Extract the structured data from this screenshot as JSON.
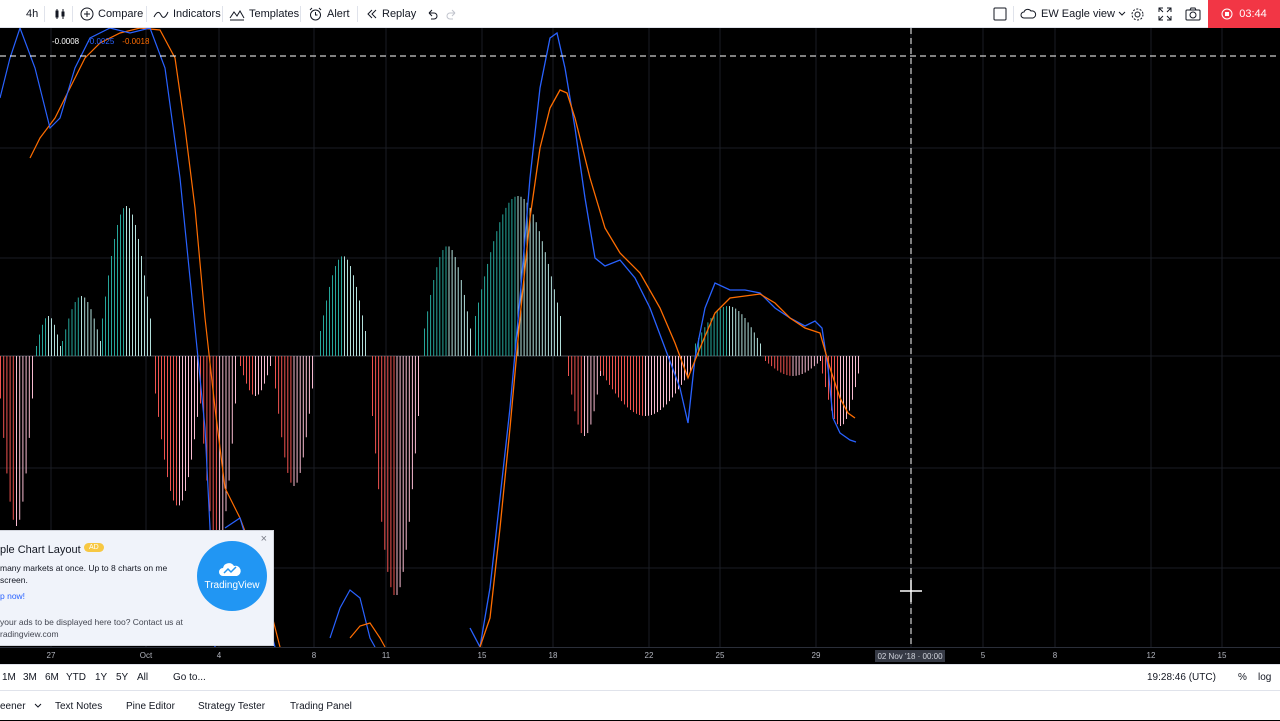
{
  "toolbar": {
    "interval": "4h",
    "compare": "Compare",
    "indicators": "Indicators",
    "templates": "Templates",
    "alert": "Alert",
    "replay": "Replay",
    "layout_name": "EW Eagle view",
    "rec_time": "03:44"
  },
  "legend": {
    "v1": "-0.0008",
    "v2": "-0.0025",
    "v3": "-0.0018",
    "colors": {
      "v1": "#ffffff",
      "v2": "#2962ff",
      "v3": "#ff6d00"
    }
  },
  "time_axis": {
    "ticks": [
      "27",
      "Oct",
      "4",
      "8",
      "11",
      "15",
      "18",
      "22",
      "25",
      "29",
      "5",
      "8",
      "12",
      "15"
    ],
    "highlight": "02 Nov '18 · 00:00"
  },
  "ranges": {
    "items": [
      "1M",
      "3M",
      "6M",
      "YTD",
      "1Y",
      "5Y",
      "All"
    ],
    "goto": "Go to...",
    "clock": "19:28:46 (UTC)",
    "percent": "%",
    "log": "log"
  },
  "bottom_tabs": [
    "eener",
    "Text Notes",
    "Pine Editor",
    "Strategy Tester",
    "Trading Panel"
  ],
  "ad": {
    "title": "ple Chart Layout",
    "badge": "AD",
    "desc": "many markets at once. Up to 8 charts on me screen.",
    "cta": "p now!",
    "foot": "your ads to be displayed here too? Contact us at radingview.com",
    "logo_text": "TradingView"
  },
  "chart_data": {
    "type": "line",
    "series": [],
    "colors": {
      "macd": "#2962ff",
      "signal": "#ff6d00",
      "hist_up": "#26a69a",
      "hist_down": "#ef5350"
    }
  }
}
